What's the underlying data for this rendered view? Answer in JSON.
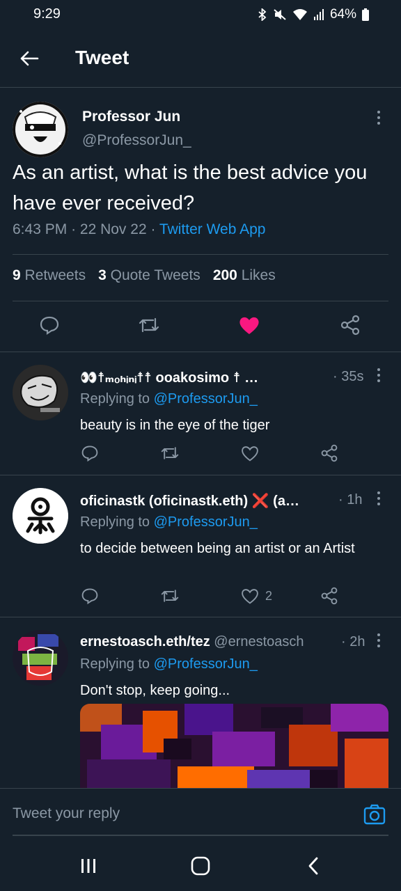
{
  "status_bar": {
    "time": "9:29",
    "battery": "64%"
  },
  "header": {
    "title": "Tweet"
  },
  "tweet": {
    "author_name": "Professor Jun",
    "author_handle": "@ProfessorJun_",
    "text": "As an artist, what is the best advice you have ever received?",
    "time": "6:43 PM",
    "date": "22 Nov 22",
    "source": "Twitter Web App",
    "stats": {
      "retweets_count": "9",
      "retweets_label": "Retweets",
      "quotes_count": "3",
      "quotes_label": "Quote Tweets",
      "likes_count": "200",
      "likes_label": "Likes"
    }
  },
  "replies": [
    {
      "name": "👀☨ₘₒₕᵢₙᵢ☨☨ ooakosimo ☨ …",
      "handle": "",
      "time": "· 35s",
      "replying_label": "Replying to",
      "replying_to": "@ProfessorJun_",
      "text": "beauty is in the eye of the tiger",
      "likes": ""
    },
    {
      "name": "oficinastk (oficinastk.eth) ❌ (a…",
      "handle": "",
      "time": "· 1h",
      "replying_label": "Replying to",
      "replying_to": "@ProfessorJun_",
      "text": "to decide between being an artist or an Artist",
      "likes": "2"
    },
    {
      "name": "ernestoasch.eth/tez",
      "handle": "@ernestoasch",
      "time": "· 2h",
      "replying_label": "Replying to",
      "replying_to": "@ProfessorJun_",
      "text": "Don't stop, keep going...",
      "likes": ""
    }
  ],
  "composer": {
    "placeholder": "Tweet your reply"
  },
  "colors": {
    "background": "#15202b",
    "accent": "#1d9bf0",
    "like": "#f91880",
    "muted": "#8b98a5",
    "border": "#38444d"
  }
}
